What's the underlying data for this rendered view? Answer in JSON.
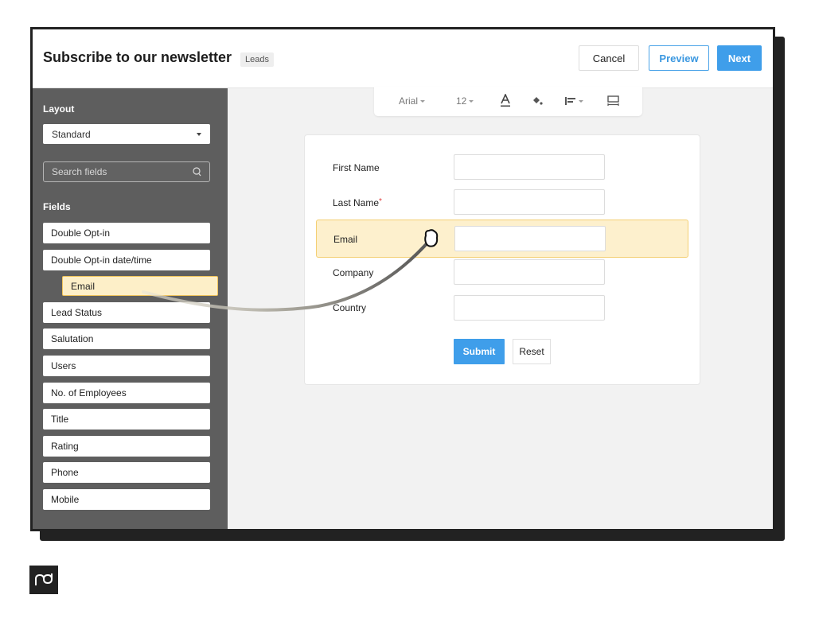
{
  "header": {
    "title": "Subscribe to our newsletter",
    "tag": "Leads",
    "buttons": {
      "cancel": "Cancel",
      "preview": "Preview",
      "next": "Next"
    }
  },
  "sidebar": {
    "layout_heading": "Layout",
    "layout_selected": "Standard",
    "search_placeholder": "Search fields",
    "fields_heading": "Fields",
    "fields": [
      {
        "label": "Double Opt-in"
      },
      {
        "label": "Double Opt-in date/time"
      },
      {
        "label": "Email",
        "dragging": true
      },
      {
        "label": "Lead Status"
      },
      {
        "label": "Salutation"
      },
      {
        "label": "Users"
      },
      {
        "label": "No. of Employees"
      },
      {
        "label": "Title"
      },
      {
        "label": "Rating"
      },
      {
        "label": "Phone"
      },
      {
        "label": "Mobile"
      }
    ]
  },
  "toolbar": {
    "font": "Arial",
    "font_size": "12",
    "icons": [
      "text-color-icon",
      "fill-color-icon",
      "align-icon",
      "layout-icon"
    ]
  },
  "form": {
    "fields": [
      {
        "label": "First Name",
        "required": false,
        "value": ""
      },
      {
        "label": "Last Name",
        "required": true,
        "value": ""
      },
      {
        "label": "Email",
        "required": false,
        "value": "",
        "highlighted": true
      },
      {
        "label": "Company",
        "required": false,
        "value": ""
      },
      {
        "label": "Country",
        "required": false,
        "value": ""
      }
    ],
    "required_marker": "*",
    "submit_label": "Submit",
    "reset_label": "Reset"
  },
  "colors": {
    "accent": "#3f9eea",
    "sidebar_bg": "#5e5e5e",
    "highlight_bg": "#fdf0cd",
    "highlight_border": "#f4cf72",
    "required": "#e04040"
  },
  "logo": {
    "name": "pipedrive-logo"
  }
}
